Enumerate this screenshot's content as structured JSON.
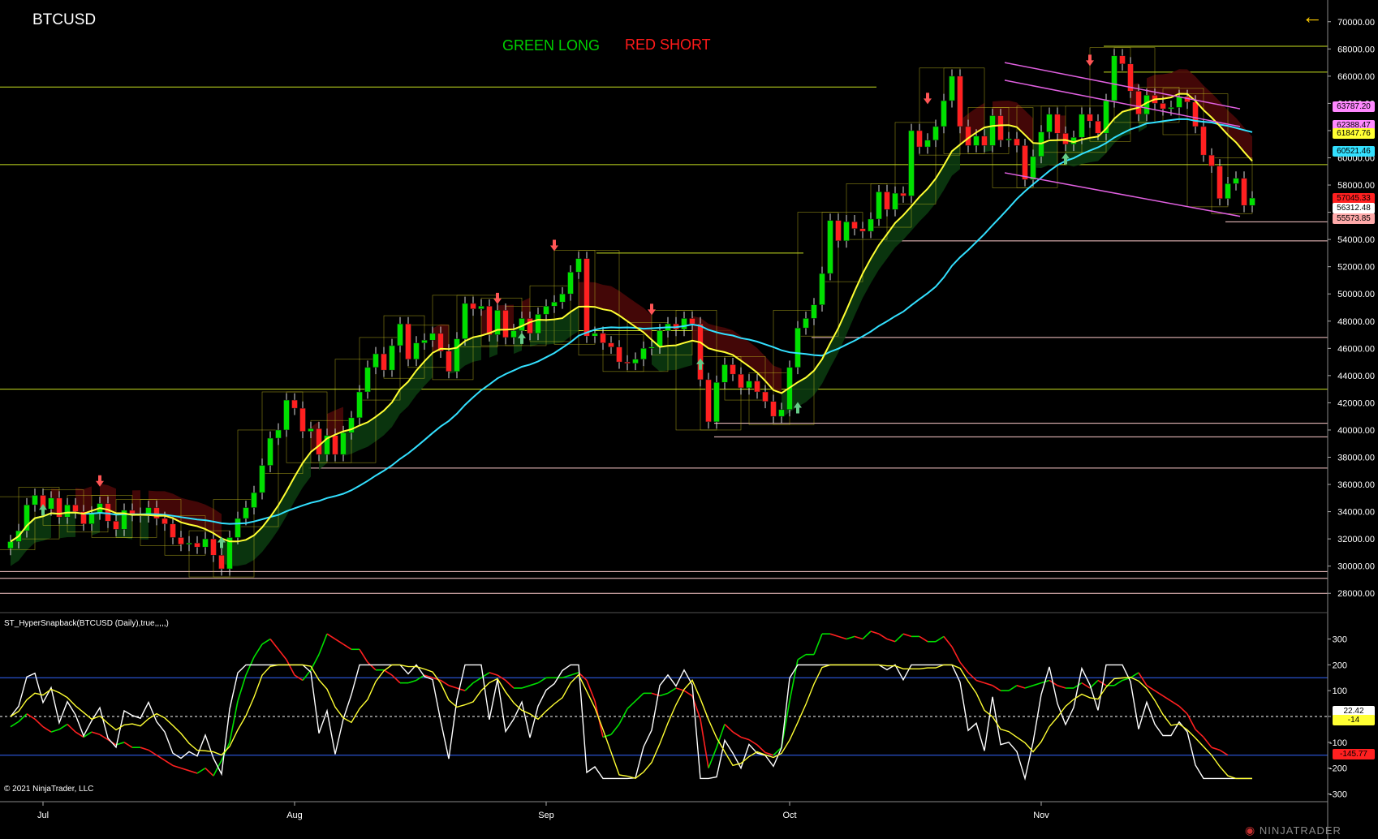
{
  "symbol": "BTCUSD",
  "legend": {
    "long": "GREEN LONG",
    "short": "RED SHORT"
  },
  "indicator_label": "ST_HyperSnapback(BTCUSD (Daily),true,,,,,)",
  "copyright": "© 2021 NinjaTrader, LLC",
  "brand": "NINJATRADER",
  "back_icon": "arrow-left-icon",
  "colors": {
    "long": "#00d000",
    "short": "#ff1a1a",
    "up_candle": "#00e000",
    "down_candle": "#ff2020",
    "sma_fast": "#ffff33",
    "sma_slow": "#33e0ff",
    "channel": "#e060e0"
  },
  "price_axis": {
    "min": 27000,
    "max": 71000,
    "ticks": [
      "70000.00",
      "68000.00",
      "66000.00",
      "64000.00",
      "62000.00",
      "60000.00",
      "58000.00",
      "56000.00",
      "54000.00",
      "52000.00",
      "50000.00",
      "48000.00",
      "46000.00",
      "44000.00",
      "42000.00",
      "40000.00",
      "38000.00",
      "36000.00",
      "34000.00",
      "32000.00",
      "30000.00",
      "28000.00"
    ]
  },
  "price_badges": [
    {
      "text": "63787.20",
      "color": "#ff88ff",
      "value": 63787
    },
    {
      "text": "62388.47",
      "color": "#ff88ff",
      "value": 62388
    },
    {
      "text": "61847.76",
      "color": "#ffff33",
      "value": 61848
    },
    {
      "text": "60521.46",
      "color": "#33e0ff",
      "value": 60521
    },
    {
      "text": "57045.33",
      "color": "#ff2020",
      "value": 57045
    },
    {
      "text": "56312.48",
      "color": "#ffffff",
      "value": 56312
    },
    {
      "text": "55573.85",
      "color": "#ffaaaa",
      "value": 55574
    }
  ],
  "osc_axis": {
    "min": -330,
    "max": 330,
    "ticks": [
      "300",
      "200",
      "100",
      "0",
      "-100",
      "-200",
      "-300"
    ]
  },
  "osc_badges": [
    {
      "text": "22.42",
      "color": "#ffffff",
      "value": 22.42
    },
    {
      "text": "-14",
      "color": "#ffff33",
      "value": -14
    },
    {
      "text": "-145.77",
      "color": "#ff2020",
      "value": -145.77
    }
  ],
  "x_axis": {
    "labels": [
      {
        "text": "Jul",
        "day": 4
      },
      {
        "text": "Aug",
        "day": 35
      },
      {
        "text": "Sep",
        "day": 66
      },
      {
        "text": "Oct",
        "day": 96
      },
      {
        "text": "Nov",
        "day": 127
      }
    ]
  },
  "chart_data": {
    "type": "candlestick",
    "closes": [
      31800,
      32600,
      34500,
      35200,
      34200,
      35000,
      33600,
      34500,
      34000,
      33100,
      33900,
      34600,
      33300,
      32700,
      34100,
      33800,
      33700,
      34300,
      33500,
      33100,
      32100,
      31600,
      31700,
      31400,
      32000,
      30800,
      29800,
      32100,
      33500,
      34300,
      35400,
      37400,
      39400,
      40000,
      42200,
      41600,
      39900,
      40100,
      38200,
      39600,
      38200,
      39800,
      40900,
      42800,
      44600,
      45600,
      44400,
      46200,
      47800,
      45200,
      46400,
      46600,
      47100,
      45800,
      44300,
      46700,
      49300,
      48900,
      49100,
      47000,
      48800,
      46800,
      47300,
      48200,
      47100,
      48500,
      49100,
      49400,
      50000,
      51600,
      52600,
      46900,
      47100,
      46400,
      46100,
      45000,
      44900,
      45200,
      46000,
      46100,
      47300,
      47800,
      47400,
      48200,
      47800,
      43700,
      40600,
      43500,
      44800,
      44100,
      43100,
      43600,
      42800,
      42100,
      41000,
      41500,
      44600,
      47500,
      48200,
      49200,
      51500,
      55400,
      53900,
      55300,
      54800,
      54600,
      55500,
      57500,
      56200,
      57400,
      57200,
      62000,
      60800,
      61300,
      62300,
      64200,
      66000,
      62300,
      60900,
      61600,
      60900,
      63100,
      61300,
      61400,
      60900,
      58400,
      60100,
      61900,
      63200,
      61800,
      61000,
      61500,
      63200,
      62700,
      61800,
      64200,
      67500,
      66900,
      64900,
      63200,
      64600,
      64000,
      63600,
      63700,
      64500,
      64100,
      62300,
      60200,
      59400,
      57000,
      58100,
      58500,
      56500,
      57045
    ],
    "series": [
      {
        "name": "ST_HyperSnapback",
        "values": [
          -40,
          -20,
          10,
          -10,
          -40,
          -60,
          -50,
          -30,
          -60,
          -80,
          -60,
          -70,
          -90,
          -110,
          -100,
          -120,
          -120,
          -130,
          -150,
          -170,
          -190,
          -200,
          -210,
          -220,
          -200,
          -230,
          -170,
          -100,
          60,
          160,
          230,
          280,
          300,
          260,
          220,
          160,
          140,
          180,
          240,
          320,
          300,
          280,
          260,
          260,
          210,
          180,
          180,
          160,
          130,
          130,
          140,
          160,
          150,
          140,
          120,
          110,
          100,
          130,
          150,
          170,
          160,
          140,
          110,
          110,
          120,
          130,
          150,
          150,
          150,
          160,
          170,
          140,
          60,
          -80,
          -70,
          -30,
          30,
          60,
          90,
          90,
          80,
          90,
          110,
          100,
          80,
          -10,
          -200,
          -120,
          -30,
          -60,
          -80,
          -90,
          -110,
          -140,
          -150,
          -120,
          60,
          220,
          240,
          240,
          320,
          320,
          310,
          300,
          310,
          300,
          330,
          320,
          300,
          290,
          320,
          310,
          310,
          290,
          290,
          310,
          270,
          210,
          170,
          140,
          130,
          120,
          100,
          100,
          120,
          110,
          120,
          130,
          140,
          120,
          110,
          110,
          130,
          110,
          140,
          120,
          120,
          140,
          150,
          170,
          120,
          100,
          80,
          60,
          40,
          10,
          -50,
          -80,
          -120,
          -130,
          -150
        ]
      }
    ],
    "title": "BTCUSD"
  }
}
